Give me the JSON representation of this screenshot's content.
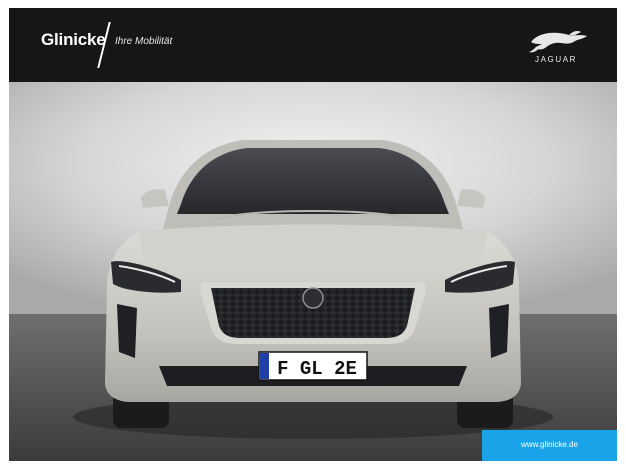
{
  "header": {
    "brand": "Glinicke",
    "tagline": "Ihre Mobilität",
    "logo_text": "JAGUAR"
  },
  "photo": {
    "plate": "F GL 2E",
    "car_color": "#c9c7c2"
  },
  "footer": {
    "url": "www.glinicke.de",
    "accent": "#1aa3e8"
  }
}
